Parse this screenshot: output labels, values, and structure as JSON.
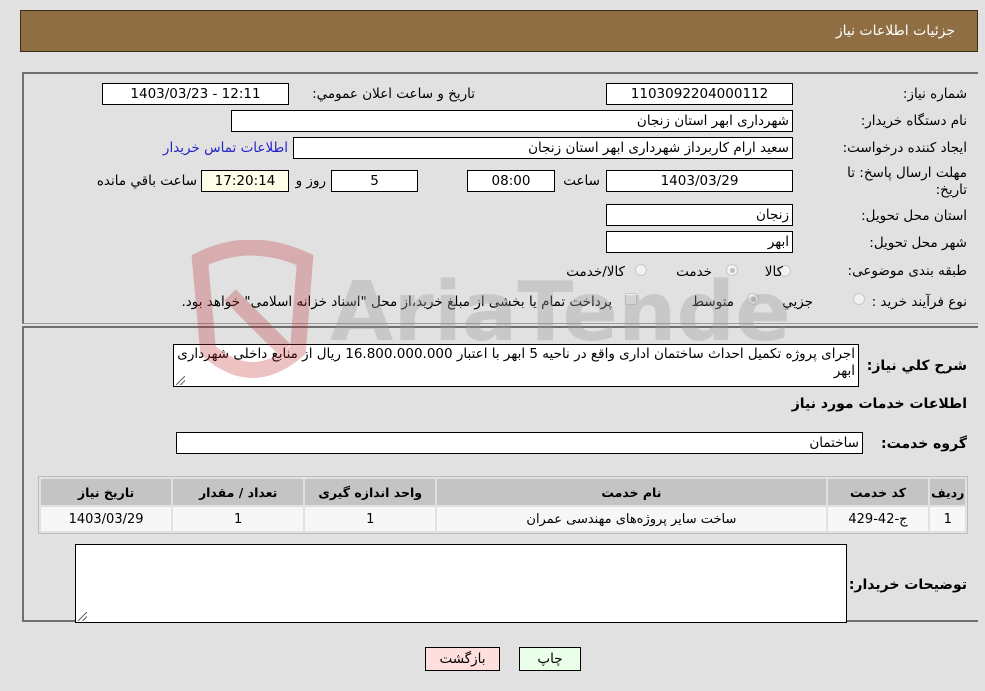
{
  "header": {
    "title": "جزئیات اطلاعات نیاز"
  },
  "fields": {
    "need_number": {
      "label": "شماره نیاز:",
      "value": "1103092204000112"
    },
    "announce_datetime": {
      "label": "تاریخ و ساعت اعلان عمومي:",
      "value": "1403/03/23 - 12:11"
    },
    "buyer_org": {
      "label": "نام دستگاه خريدار:",
      "value": "شهرداری ابهر استان زنجان"
    },
    "requester": {
      "label": "ایجاد کننده درخواست:",
      "value": "سعید ارام کاربرداز  شهرداری ابهر استان زنجان"
    },
    "buyer_contact_link": "اطلاعات تماس خریدار",
    "deadline": {
      "label_line1": "مهلت ارسال پاسخ: تا",
      "label_line2": "تاریخ:",
      "date": "1403/03/29",
      "time_label": "ساعت",
      "time": "08:00",
      "days": "5",
      "days_label": "روز و",
      "remaining": "17:20:14",
      "remaining_label": "ساعت باقي مانده"
    },
    "province": {
      "label": "استان محل تحویل:",
      "value": "زنجان"
    },
    "city": {
      "label": "شهر محل تحویل:",
      "value": "ابهر"
    },
    "category": {
      "label": "طبقه بندی موضوعی:",
      "options": [
        "کالا",
        "خدمت",
        "کالا/خدمت"
      ],
      "selected": "خدمت"
    },
    "purchase_type": {
      "label": "نوع فرآیند خرید :",
      "options": [
        "جزیي",
        "متوسط"
      ],
      "selected": "متوسط",
      "treasury_checkbox_label": "پرداخت تمام یا بخشی از مبلغ خرید،از محل \"اسناد خزانه اسلامی\" خواهد بود.",
      "treasury_checked": false
    }
  },
  "description": {
    "label": "شرح كلي نياز:",
    "value": "اجرای پروژه تکمیل احداث ساختمان اداری واقع در ناحیه 5 ابهر با اعتبار 16.800.000.000 ریال از منابع داخلی شهرداری ابهر"
  },
  "services_section": {
    "title": "اطلاعات خدمات مورد نیاز",
    "group_label": "گروه خدمت:",
    "group_value": "ساختمان",
    "table": {
      "headers": [
        "ردیف",
        "کد خدمت",
        "نام خدمت",
        "واحد اندازه گیری",
        "تعداد / مقدار",
        "تاریخ نیاز"
      ],
      "rows": [
        [
          "1",
          "ج-42-429",
          "ساخت سایر پروژه‌های مهندسی عمران",
          "1",
          "1",
          "1403/03/29"
        ]
      ]
    }
  },
  "buyer_notes": {
    "label": "توضیحات خریدار:",
    "value": ""
  },
  "buttons": {
    "print": "چاپ",
    "back": "بازگشت"
  },
  "colors": {
    "header_bg": "#8e6e42",
    "link": "#2424c8",
    "print_bg": "#eaffea",
    "back_bg": "#ffdede"
  },
  "watermark": {
    "text": "AriaTender.net"
  }
}
